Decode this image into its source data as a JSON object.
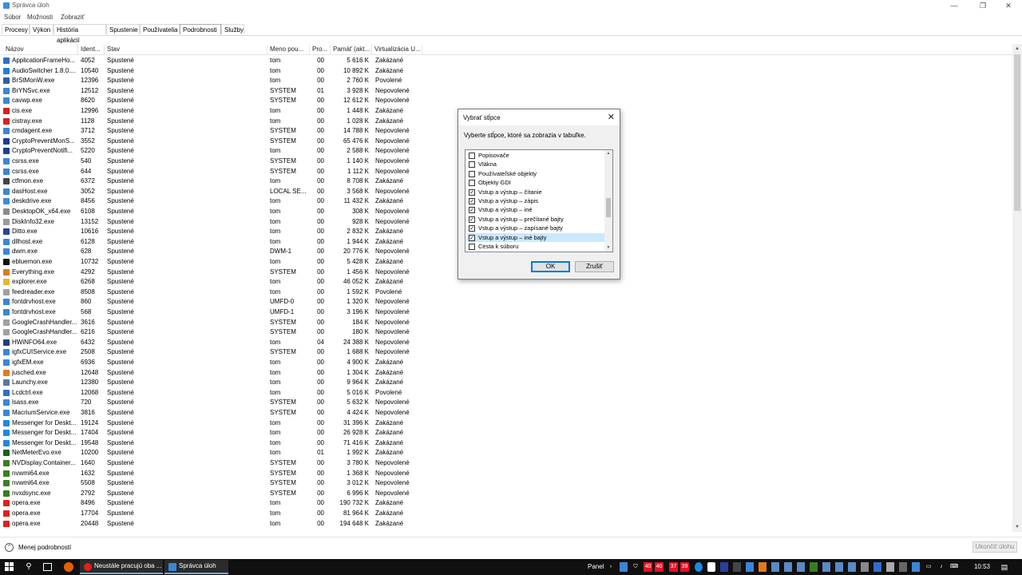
{
  "window": {
    "title": "Správca úloh"
  },
  "window_controls": {
    "minimize": "—",
    "maximize": "❐",
    "close": "✕"
  },
  "menu": [
    "Súbor",
    "Možnosti",
    "Zobraziť"
  ],
  "tabs": [
    "Procesy",
    "Výkon",
    "História aplikácií",
    "Spustenie",
    "Používatelia",
    "Podrobnosti",
    "Služby"
  ],
  "active_tab": "Podrobnosti",
  "columns": [
    "Názov",
    "Ident...",
    "Stav",
    "Meno pou...",
    "Pro...",
    "Pamäť (akt...",
    "Virtualizácia U..."
  ],
  "rows": [
    {
      "name": "ApplicationFrameHo...",
      "pid": "4052",
      "status": "Spustené",
      "user": "tom",
      "cpu": "00",
      "mem": "5 616 K",
      "virt": "Zakázané",
      "icon": "#2f6fc9"
    },
    {
      "name": "AudioSwitcher 1.8.0....",
      "pid": "10540",
      "status": "Spustené",
      "user": "tom",
      "cpu": "00",
      "mem": "10 892 K",
      "virt": "Zakázané",
      "icon": "#1d7dd8"
    },
    {
      "name": "BrStMonW.exe",
      "pid": "12396",
      "status": "Spustené",
      "user": "tom",
      "cpu": "00",
      "mem": "2 760 K",
      "virt": "Povolené",
      "icon": "#2c5fa8"
    },
    {
      "name": "BrYNSvc.exe",
      "pid": "12512",
      "status": "Spustené",
      "user": "SYSTEM",
      "cpu": "01",
      "mem": "3 928 K",
      "virt": "Nepovolené",
      "icon": "#3a86d6"
    },
    {
      "name": "cavwp.exe",
      "pid": "8620",
      "status": "Spustené",
      "user": "SYSTEM",
      "cpu": "00",
      "mem": "12 612 K",
      "virt": "Nepovolené",
      "icon": "#3a86d6"
    },
    {
      "name": "cis.exe",
      "pid": "12996",
      "status": "Spustené",
      "user": "tom",
      "cpu": "00",
      "mem": "1 448 K",
      "virt": "Zakázané",
      "icon": "#d32222"
    },
    {
      "name": "cistray.exe",
      "pid": "1128",
      "status": "Spustené",
      "user": "tom",
      "cpu": "00",
      "mem": "1 028 K",
      "virt": "Zakázané",
      "icon": "#d32222"
    },
    {
      "name": "cmdagent.exe",
      "pid": "3712",
      "status": "Spustené",
      "user": "SYSTEM",
      "cpu": "00",
      "mem": "14 788 K",
      "virt": "Nepovolené",
      "icon": "#3a86d6"
    },
    {
      "name": "CryptoPreventMonS...",
      "pid": "3552",
      "status": "Spustené",
      "user": "SYSTEM",
      "cpu": "00",
      "mem": "65 476 K",
      "virt": "Nepovolené",
      "icon": "#1b3f8f"
    },
    {
      "name": "CryptoPreventNotifi...",
      "pid": "5220",
      "status": "Spustené",
      "user": "tom",
      "cpu": "00",
      "mem": "2 588 K",
      "virt": "Nepovolené",
      "icon": "#1b3f8f"
    },
    {
      "name": "csrss.exe",
      "pid": "540",
      "status": "Spustené",
      "user": "SYSTEM",
      "cpu": "00",
      "mem": "1 140 K",
      "virt": "Nepovolené",
      "icon": "#3a86d6"
    },
    {
      "name": "csrss.exe",
      "pid": "644",
      "status": "Spustené",
      "user": "SYSTEM",
      "cpu": "00",
      "mem": "1 112 K",
      "virt": "Nepovolené",
      "icon": "#3a86d6"
    },
    {
      "name": "ctfmon.exe",
      "pid": "6372",
      "status": "Spustené",
      "user": "tom",
      "cpu": "00",
      "mem": "8 708 K",
      "virt": "Zakázané",
      "icon": "#444444"
    },
    {
      "name": "dasHost.exe",
      "pid": "3052",
      "status": "Spustené",
      "user": "LOCAL SE...",
      "cpu": "00",
      "mem": "3 568 K",
      "virt": "Nepovolené",
      "icon": "#3a86d6"
    },
    {
      "name": "deskdrive.exe",
      "pid": "8456",
      "status": "Spustené",
      "user": "tom",
      "cpu": "00",
      "mem": "11 432 K",
      "virt": "Zakázané",
      "icon": "#3f8be0"
    },
    {
      "name": "DesktopOK_x64.exe",
      "pid": "6108",
      "status": "Spustené",
      "user": "tom",
      "cpu": "00",
      "mem": "308 K",
      "virt": "Nepovolené",
      "icon": "#8a8a8a"
    },
    {
      "name": "DiskInfo32.exe",
      "pid": "13152",
      "status": "Spustené",
      "user": "tom",
      "cpu": "00",
      "mem": "928 K",
      "virt": "Nepovolené",
      "icon": "#9a9a9a"
    },
    {
      "name": "Ditto.exe",
      "pid": "10616",
      "status": "Spustené",
      "user": "tom",
      "cpu": "00",
      "mem": "2 832 K",
      "virt": "Zakázané",
      "icon": "#2a3f9f"
    },
    {
      "name": "dllhost.exe",
      "pid": "6128",
      "status": "Spustené",
      "user": "tom",
      "cpu": "00",
      "mem": "1 944 K",
      "virt": "Zakázané",
      "icon": "#3a86d6"
    },
    {
      "name": "dwm.exe",
      "pid": "628",
      "status": "Spustené",
      "user": "DWM-1",
      "cpu": "00",
      "mem": "20 776 K",
      "virt": "Nepovolené",
      "icon": "#3a86d6"
    },
    {
      "name": "ebluemon.exe",
      "pid": "10732",
      "status": "Spustené",
      "user": "tom",
      "cpu": "00",
      "mem": "5 428 K",
      "virt": "Zakázané",
      "icon": "#111111"
    },
    {
      "name": "Everything.exe",
      "pid": "4292",
      "status": "Spustené",
      "user": "SYSTEM",
      "cpu": "00",
      "mem": "1 456 K",
      "virt": "Nepovolené",
      "icon": "#e07b1a"
    },
    {
      "name": "explorer.exe",
      "pid": "6268",
      "status": "Spustené",
      "user": "tom",
      "cpu": "00",
      "mem": "46 052 K",
      "virt": "Zakázané",
      "icon": "#e8b530"
    },
    {
      "name": "feedreader.exe",
      "pid": "8508",
      "status": "Spustené",
      "user": "tom",
      "cpu": "00",
      "mem": "1 592 K",
      "virt": "Povolené",
      "icon": "#a0a0a0"
    },
    {
      "name": "fontdrvhost.exe",
      "pid": "860",
      "status": "Spustené",
      "user": "UMFD-0",
      "cpu": "00",
      "mem": "1 320 K",
      "virt": "Nepovolené",
      "icon": "#3a86d6"
    },
    {
      "name": "fontdrvhost.exe",
      "pid": "568",
      "status": "Spustené",
      "user": "UMFD-1",
      "cpu": "00",
      "mem": "3 196 K",
      "virt": "Nepovolené",
      "icon": "#3a86d6"
    },
    {
      "name": "GoogleCrashHandler...",
      "pid": "3616",
      "status": "Spustené",
      "user": "SYSTEM",
      "cpu": "00",
      "mem": "184 K",
      "virt": "Nepovolené",
      "icon": "#a0a0a0"
    },
    {
      "name": "GoogleCrashHandler...",
      "pid": "6216",
      "status": "Spustené",
      "user": "SYSTEM",
      "cpu": "00",
      "mem": "180 K",
      "virt": "Nepovolené",
      "icon": "#a0a0a0"
    },
    {
      "name": "HWiNFO64.exe",
      "pid": "6432",
      "status": "Spustené",
      "user": "tom",
      "cpu": "04",
      "mem": "24 388 K",
      "virt": "Nepovolené",
      "icon": "#1f3f7f"
    },
    {
      "name": "igfxCUIService.exe",
      "pid": "2508",
      "status": "Spustené",
      "user": "SYSTEM",
      "cpu": "00",
      "mem": "1 688 K",
      "virt": "Nepovolené",
      "icon": "#3a86d6"
    },
    {
      "name": "igfxEM.exe",
      "pid": "6936",
      "status": "Spustené",
      "user": "tom",
      "cpu": "00",
      "mem": "4 900 K",
      "virt": "Zakázané",
      "icon": "#3a86d6"
    },
    {
      "name": "jusched.exe",
      "pid": "12648",
      "status": "Spustené",
      "user": "tom",
      "cpu": "00",
      "mem": "1 304 K",
      "virt": "Zakázané",
      "icon": "#e07b1a"
    },
    {
      "name": "Launchy.exe",
      "pid": "12380",
      "status": "Spustené",
      "user": "tom",
      "cpu": "00",
      "mem": "9 964 K",
      "virt": "Zakázané",
      "icon": "#5a7a9a"
    },
    {
      "name": "Lcdctrl.exe",
      "pid": "12068",
      "status": "Spustené",
      "user": "tom",
      "cpu": "00",
      "mem": "5 016 K",
      "virt": "Povolené",
      "icon": "#2f6fc9"
    },
    {
      "name": "lsass.exe",
      "pid": "720",
      "status": "Spustené",
      "user": "SYSTEM",
      "cpu": "00",
      "mem": "5 632 K",
      "virt": "Nepovolené",
      "icon": "#3a86d6"
    },
    {
      "name": "MacriumService.exe",
      "pid": "3816",
      "status": "Spustené",
      "user": "SYSTEM",
      "cpu": "00",
      "mem": "4 424 K",
      "virt": "Nepovolené",
      "icon": "#3a86d6"
    },
    {
      "name": "Messenger for Deskt...",
      "pid": "19124",
      "status": "Spustené",
      "user": "tom",
      "cpu": "00",
      "mem": "31 396 K",
      "virt": "Zakázané",
      "icon": "#1e88e5"
    },
    {
      "name": "Messenger for Deskt...",
      "pid": "17404",
      "status": "Spustené",
      "user": "tom",
      "cpu": "00",
      "mem": "26 928 K",
      "virt": "Zakázané",
      "icon": "#1e88e5"
    },
    {
      "name": "Messenger for Deskt...",
      "pid": "19548",
      "status": "Spustené",
      "user": "tom",
      "cpu": "00",
      "mem": "71 416 K",
      "virt": "Zakázané",
      "icon": "#1e88e5"
    },
    {
      "name": "NetMeterEvo.exe",
      "pid": "10200",
      "status": "Spustené",
      "user": "tom",
      "cpu": "01",
      "mem": "1 992 K",
      "virt": "Zakázané",
      "icon": "#1b5e20"
    },
    {
      "name": "NVDisplay.Container...",
      "pid": "1640",
      "status": "Spustené",
      "user": "SYSTEM",
      "cpu": "00",
      "mem": "3 780 K",
      "virt": "Nepovolené",
      "icon": "#3a7d1e"
    },
    {
      "name": "nvwmi64.exe",
      "pid": "1632",
      "status": "Spustené",
      "user": "SYSTEM",
      "cpu": "00",
      "mem": "1 368 K",
      "virt": "Nepovolené",
      "icon": "#3a7d1e"
    },
    {
      "name": "nvwmi64.exe",
      "pid": "5508",
      "status": "Spustené",
      "user": "SYSTEM",
      "cpu": "00",
      "mem": "3 012 K",
      "virt": "Nepovolené",
      "icon": "#3a7d1e"
    },
    {
      "name": "nvxdsync.exe",
      "pid": "2792",
      "status": "Spustené",
      "user": "SYSTEM",
      "cpu": "00",
      "mem": "6 996 K",
      "virt": "Nepovolené",
      "icon": "#3a7d1e"
    },
    {
      "name": "opera.exe",
      "pid": "8496",
      "status": "Spustené",
      "user": "tom",
      "cpu": "00",
      "mem": "190 732 K",
      "virt": "Zakázané",
      "icon": "#e0201e"
    },
    {
      "name": "opera.exe",
      "pid": "17704",
      "status": "Spustené",
      "user": "tom",
      "cpu": "00",
      "mem": "81 964 K",
      "virt": "Zakázané",
      "icon": "#e0201e"
    },
    {
      "name": "opera.exe",
      "pid": "20448",
      "status": "Spustené",
      "user": "tom",
      "cpu": "00",
      "mem": "194 648 K",
      "virt": "Zakázané",
      "icon": "#e0201e"
    }
  ],
  "footer": {
    "fewer_details": "Menej podrobností",
    "end_task": "Ukončiť úlohu"
  },
  "dialog": {
    "title": "Vybrať stĺpce",
    "instruction": "Vyberte stĺpce, ktoré sa zobrazia v tabuľke.",
    "items": [
      {
        "label": "Popisovače",
        "checked": false
      },
      {
        "label": "Vlákna",
        "checked": false
      },
      {
        "label": "Používateľské objekty",
        "checked": false
      },
      {
        "label": "Objekty GDI",
        "checked": false
      },
      {
        "label": "Vstup a výstup – čítanie",
        "checked": true
      },
      {
        "label": "Vstup a výstup – zápis",
        "checked": true
      },
      {
        "label": "Vstup a výstup – iné",
        "checked": true
      },
      {
        "label": "Vstup a výstup – prečítané bajty",
        "checked": true
      },
      {
        "label": "Vstup a výstup – zapísané bajty",
        "checked": true
      },
      {
        "label": "Vstup a výstup – iné bajty",
        "checked": true,
        "selected": true
      },
      {
        "label": "Cesta k súboru",
        "checked": false
      }
    ],
    "ok": "OK",
    "cancel": "Zrušiť"
  },
  "taskbar": {
    "tasks": [
      {
        "label": "Neustále pracujú oba ...",
        "icon_color": "#e0201e"
      },
      {
        "label": "Správca úloh",
        "icon_color": "#3a86d6"
      }
    ],
    "panel_label": "Panel",
    "tray_temps": [
      "40",
      "40",
      "37",
      "39"
    ],
    "clock": "10:53"
  },
  "colors": {
    "accent": "#0078d7",
    "selection": "#cce8ff",
    "taskbar": "#101010",
    "tray_temp": "#e81123"
  }
}
